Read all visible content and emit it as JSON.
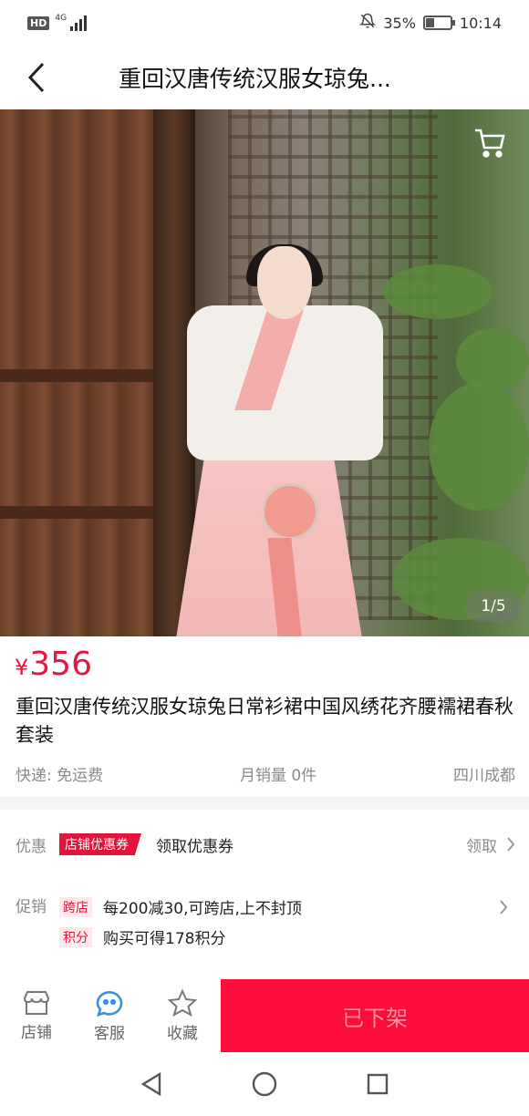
{
  "status_bar": {
    "network_badge": "HD",
    "network_type": "4G",
    "battery_percent": "35%",
    "battery_level": 0.35,
    "time": "10:14",
    "icons": [
      "hd-icon",
      "signal-icon",
      "mute-icon",
      "battery-icon"
    ]
  },
  "header": {
    "title": "重回汉唐传统汉服女琼兔...",
    "back_icon": "chevron-left-icon"
  },
  "gallery": {
    "cart_icon": "cart-icon",
    "page_indicator": "1/5"
  },
  "product": {
    "currency": "¥",
    "price": "356",
    "title": "重回汉唐传统汉服女琼兔日常衫裙中国风绣花齐腰襦裙春秋套装",
    "shipping": "快递: 免运费",
    "monthly_sales": "月销量 0件",
    "location": "四川成都"
  },
  "coupon": {
    "label": "优惠",
    "tag": "店铺优惠券",
    "text": "领取优惠券",
    "action": "领取"
  },
  "promo": {
    "label": "促销",
    "items": [
      {
        "tag": "跨店",
        "text": "每200减30,可跨店,上不封顶"
      },
      {
        "tag": "积分",
        "text": "购买可得178积分"
      }
    ]
  },
  "actions": {
    "store": "店铺",
    "service": "客服",
    "favorite": "收藏",
    "status_button": "已下架"
  },
  "colors": {
    "accent": "#e4173f",
    "button": "#fc0d3a",
    "service_icon": "#3a8ee6"
  }
}
